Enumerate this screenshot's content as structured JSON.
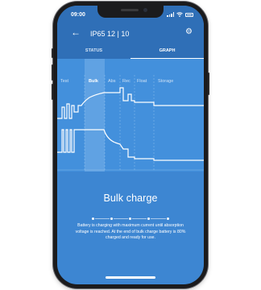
{
  "status_bar": {
    "time": "09:00"
  },
  "header": {
    "back_glyph": "←",
    "title": "IP65 12 | 10",
    "settings_glyph": "⚙"
  },
  "tabs": [
    {
      "label": "STATUS",
      "active": false
    },
    {
      "label": "GRAPH",
      "active": true
    }
  ],
  "graph": {
    "phases": [
      "Test",
      "Bulk",
      "Abs",
      "Rec",
      "Float",
      "Storage"
    ],
    "active_phase": "Bulk"
  },
  "caption": {
    "title": "Bulk charge",
    "description": "Battery is charging with maximum current until absorption voltage is reached. At the end of bulk charge battery is 80% charged and ready for use."
  },
  "colors": {
    "screen_bg": "#3d86d2",
    "app_bar": "#2f6fb7",
    "graph_bg": "#4390dc",
    "highlight": "#ffffff"
  },
  "icons": {
    "back": "arrow-left-icon",
    "settings": "gear-icon",
    "signal": "cellular-signal-icon",
    "wifi": "wifi-icon",
    "battery": "battery-icon"
  }
}
